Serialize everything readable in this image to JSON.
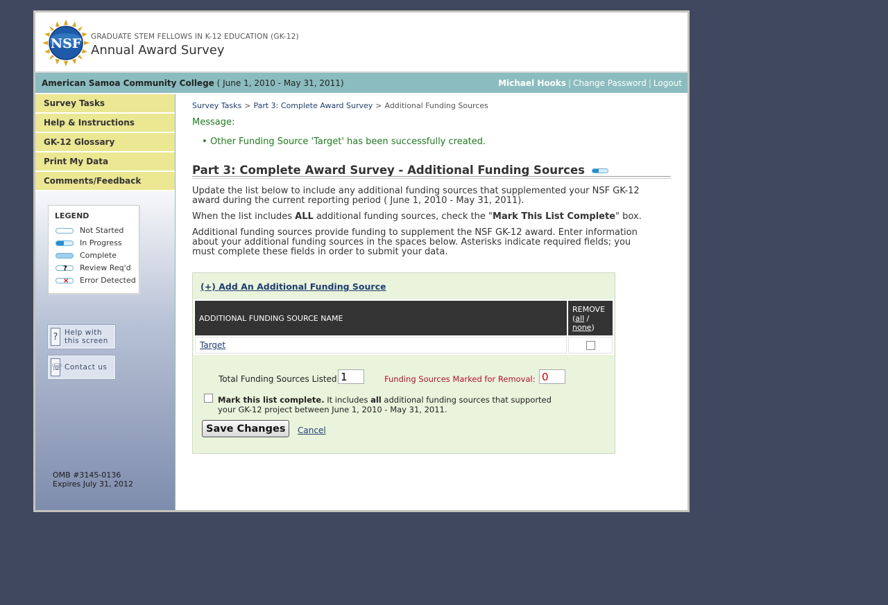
{
  "header": {
    "program": "GRADUATE STEM FELLOWS IN K-12 EDUCATION (GK-12)",
    "title": "Annual Award Survey",
    "logo_text": "NSF"
  },
  "infobar": {
    "institution": "American Samoa Community College",
    "period": "( June 1, 2010 - May 31, 2011)",
    "user": "Michael Hooks",
    "change_password": "Change Password",
    "logout": "Logout"
  },
  "sidebar": {
    "items": [
      {
        "label": "Survey Tasks"
      },
      {
        "label": "Help & Instructions"
      },
      {
        "label": "GK-12 Glossary"
      },
      {
        "label": "Print My Data"
      },
      {
        "label": "Comments/Feedback"
      }
    ],
    "legend": {
      "title": "LEGEND",
      "entries": [
        {
          "label": "Not Started"
        },
        {
          "label": "In Progress"
        },
        {
          "label": "Complete"
        },
        {
          "label": "Review Req'd"
        },
        {
          "label": "Error Detected"
        }
      ]
    },
    "help_button": {
      "line1": "Help with",
      "line2": "this screen"
    },
    "contact_button": {
      "label": "Contact us"
    },
    "omb": {
      "line1": "OMB #3145-0136",
      "line2": "Expires July 31, 2012"
    }
  },
  "main": {
    "breadcrumb": {
      "link1": "Survey Tasks",
      "link2": "Part 3: Complete Award Survey",
      "current": "Additional Funding Sources"
    },
    "message_label": "Message:",
    "message": "Other Funding Source 'Target' has been successfully created.",
    "title": "Part 3: Complete Award Survey - Additional Funding Sources",
    "para1": "Update the list below to include any additional funding sources that supplemented your NSF GK-12 award during the current reporting period ( June 1, 2010 - May 31, 2011).",
    "para2_a": "When the list includes ",
    "para2_b": "ALL",
    "para2_c": " additional funding sources, check the \"",
    "para2_d": "Mark This List Complete",
    "para2_e": "\" box.",
    "para3": "Additional funding sources provide funding to supplement the NSF GK-12 award. Enter information about your additional funding sources in the spaces below. Asterisks indicate required fields; you must complete these fields in order to submit your data.",
    "add_link": "(+) Add An Additional Funding Source",
    "table": {
      "col_name": "ADDITIONAL FUNDING SOURCE NAME",
      "col_remove": "REMOVE",
      "remove_all": "all",
      "remove_slash": " /",
      "remove_none": "none",
      "rows": [
        {
          "name": "Target"
        }
      ]
    },
    "totals_label": "Total Funding Sources Listed:",
    "totals_value": "1",
    "removal_label": "Funding Sources Marked for Removal:",
    "removal_value": "0",
    "complete_bold": "Mark this list complete.",
    "complete_text_a": " It includes ",
    "complete_all": "all",
    "complete_text_b": " additional funding sources that supported your GK-12 project between June 1, 2010 - May 31, 2011.",
    "save_label": "Save Changes",
    "cancel_label": "Cancel"
  }
}
